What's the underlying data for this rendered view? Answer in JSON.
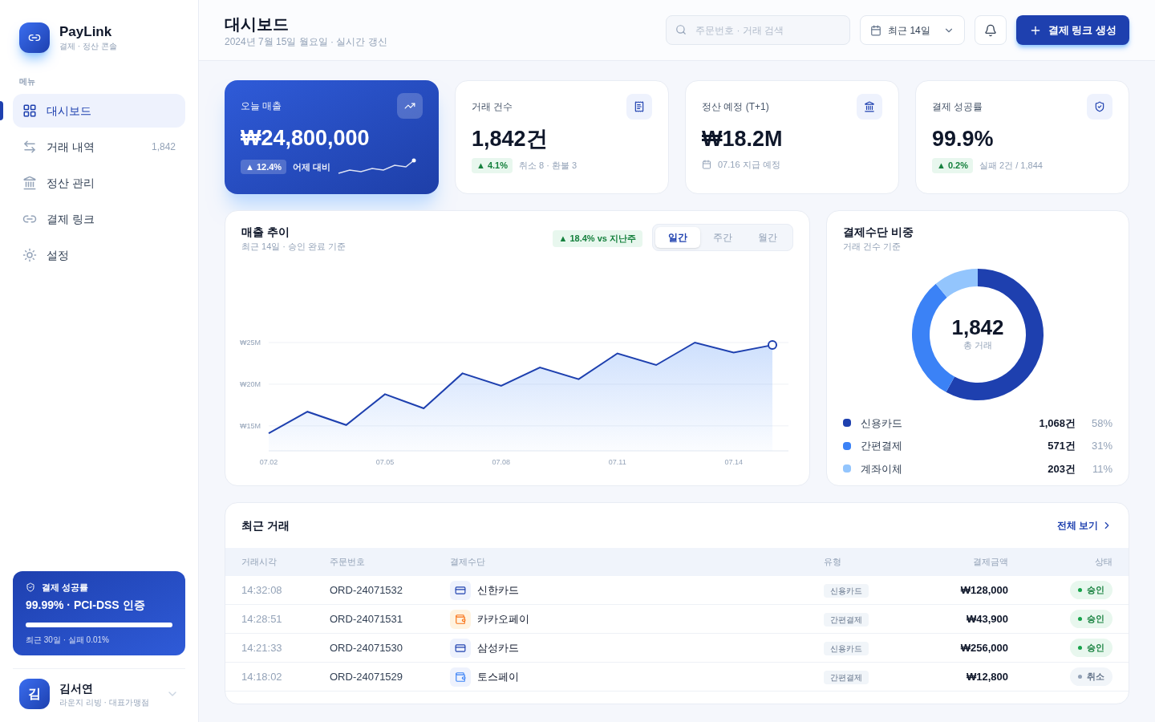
{
  "brand": {
    "name": "PayLink",
    "tagline": "결제 · 정산 콘솔"
  },
  "sidebar": {
    "section_label": "메뉴",
    "items": [
      {
        "label": "대시보드",
        "selected": true
      },
      {
        "label": "거래 내역",
        "selected": false,
        "count": "1,842"
      },
      {
        "label": "정산 관리",
        "selected": false
      },
      {
        "label": "결제 링크",
        "selected": false
      },
      {
        "label": "설정",
        "selected": false
      }
    ],
    "promo": {
      "title": "결제 성공률",
      "headline": "99.99% · PCI-DSS 인증",
      "level": 0.9999,
      "caption": "최근 30일 · 실패 0.01%"
    },
    "user": {
      "initial": "김",
      "name": "김서연",
      "role": "라운지 리빙 · 대표가맹점"
    }
  },
  "header": {
    "title": "대시보드",
    "subtitle": "2024년 7월 15일 월요일 · 실시간 갱신",
    "search": {
      "placeholder": "주문번호 · 거래 검색"
    },
    "period": "최근 14일",
    "create_button": "결제 링크 생성"
  },
  "kpis": [
    {
      "kind": "hero",
      "label": "오늘 매출",
      "value": "₩24,800,000",
      "delta": "▲ 12.4%",
      "note": "어제 대비"
    },
    {
      "kind": "delta",
      "label": "거래 건수",
      "value": "1,842건",
      "delta": "▲ 4.1%",
      "note": "취소 8 · 환불 3"
    },
    {
      "kind": "date",
      "label": "정산 예정 (T+1)",
      "value": "₩18.2M",
      "note": "07.16 지급 예정"
    },
    {
      "kind": "delta",
      "label": "결제 성공률",
      "value": "99.9%",
      "delta": "▲ 0.2%",
      "note": "실패 2건 / 1,844"
    }
  ],
  "sales_trend": {
    "title": "매출 추이",
    "subtitle": "최근 14일 · 승인 완료 기준",
    "badge": "▲ 18.4% vs 지난주",
    "tabs": [
      {
        "label": "일간",
        "selected": true
      },
      {
        "label": "주간",
        "selected": false
      },
      {
        "label": "월간",
        "selected": false
      }
    ],
    "chart_data": {
      "type": "area",
      "grid": true,
      "categories": [
        "07.02",
        null,
        null,
        "07.05",
        null,
        null,
        "07.08",
        null,
        null,
        "07.11",
        null,
        null,
        "07.14",
        null
      ],
      "series": [
        {
          "color": "#1e40af",
          "values": [
            14.1,
            16.7,
            15.1,
            18.8,
            17.1,
            21.3,
            19.8,
            22.0,
            20.6,
            23.7,
            22.3,
            25.0,
            23.8,
            24.7
          ]
        }
      ],
      "ylim": [
        12,
        25
      ],
      "yticks": [
        {
          "value": 15,
          "label": "₩15M"
        },
        {
          "value": 20,
          "label": "₩20M"
        },
        {
          "value": 25,
          "label": "₩25M"
        }
      ]
    }
  },
  "payment_mix": {
    "title": "결제수단 비중",
    "subtitle": "거래 건수 기준",
    "center_value": "1,842",
    "center_label": "총 거래",
    "chart_data": {
      "type": "donut",
      "categories": [
        "신용카드",
        "간편결제",
        "계좌이체"
      ],
      "series": [
        {
          "colors": [
            "#1e40af",
            "#3b82f6",
            "#93c5fd"
          ],
          "values": [
            58,
            31,
            11
          ]
        }
      ]
    },
    "legend": [
      {
        "count": "1,068건",
        "share": "58%",
        "color": "#1e40af"
      },
      {
        "count": "571건",
        "share": "31%",
        "color": "#3b82f6"
      },
      {
        "count": "203건",
        "share": "11%",
        "color": "#93c5fd"
      }
    ]
  },
  "recent": {
    "title": "최근 거래",
    "view_all": "전체 보기",
    "columns": [
      "거래시각",
      "주문번호",
      "결제수단",
      "유형",
      "결제금액",
      "상태"
    ],
    "rows": [
      {
        "time": "14:32:08",
        "order": "ORD-24071532",
        "method": {
          "label": "신한카드",
          "kind": "card"
        },
        "type": "신용카드",
        "amount": "₩128,000",
        "status": {
          "label": "승인",
          "kind": "approved"
        }
      },
      {
        "time": "14:28:51",
        "order": "ORD-24071531",
        "method": {
          "label": "카카오페이",
          "kind": "wallet"
        },
        "type": "간편결제",
        "amount": "₩43,900",
        "status": {
          "label": "승인",
          "kind": "approved"
        }
      },
      {
        "time": "14:21:33",
        "order": "ORD-24071530",
        "method": {
          "label": "삼성카드",
          "kind": "card"
        },
        "type": "신용카드",
        "amount": "₩256,000",
        "status": {
          "label": "승인",
          "kind": "approved"
        }
      },
      {
        "time": "14:18:02",
        "order": "ORD-24071529",
        "method": {
          "label": "토스페이",
          "kind": "app"
        },
        "type": "간편결제",
        "amount": "₩12,800",
        "status": {
          "label": "취소",
          "kind": "cancelled"
        }
      }
    ]
  }
}
